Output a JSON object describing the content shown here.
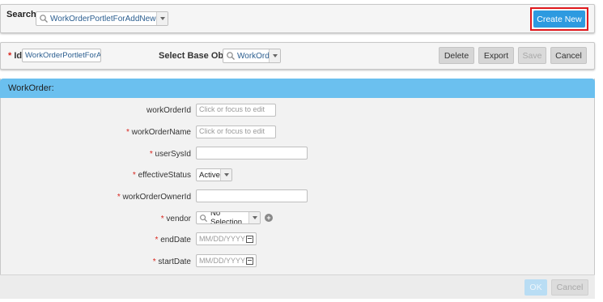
{
  "search": {
    "label": "Search :",
    "value": "WorkOrderPortletForAddNewCWF (...",
    "create_label": "Create New"
  },
  "toolbar": {
    "id_required": "*",
    "id_label": "Id",
    "id_value": "WorkOrderPortletForAddNe",
    "base_label": "Select Base Object",
    "base_value": "WorkOrder",
    "delete_label": "Delete",
    "export_label": "Export",
    "save_label": "Save",
    "cancel_label": "Cancel"
  },
  "form": {
    "title": "WorkOrder:",
    "placeholder_edit": "Click or focus to edit",
    "fields": [
      {
        "label": "workOrderId",
        "required": false
      },
      {
        "label": "workOrderName",
        "required": true
      },
      {
        "label": "userSysId",
        "required": true
      },
      {
        "label": "effectiveStatus",
        "required": true,
        "value": "Active"
      },
      {
        "label": "workOrderOwnerId",
        "required": true
      },
      {
        "label": "vendor",
        "required": true,
        "value": "No Selection"
      },
      {
        "label": "endDate",
        "required": true,
        "placeholder": "MM/DD/YYYY"
      },
      {
        "label": "startDate",
        "required": true,
        "placeholder": "MM/DD/YYYY"
      }
    ],
    "required_mark": "*",
    "add_icon": "+"
  },
  "footer": {
    "ok_label": "OK",
    "cancel_label": "Cancel"
  },
  "colors": {
    "accent": "#2d9ae0",
    "header": "#6bc0ef",
    "highlight": "#e0191d",
    "required": "#d9251d"
  }
}
